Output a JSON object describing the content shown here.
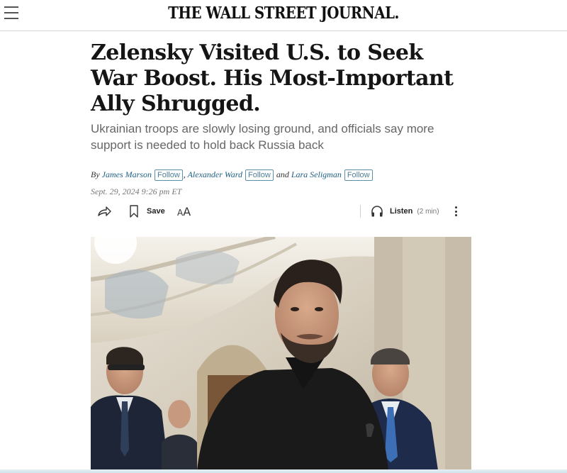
{
  "masthead": {
    "title": "THE WALL STREET JOURNAL."
  },
  "article": {
    "headline": "Zelensky Visited U.S. to Seek War Boost. His Most-Important Ally Shrugged.",
    "dek": "Ukrainian troops are slowly losing ground, and officials say more support is needed to hold back Russia back",
    "byline": {
      "by": "By",
      "authors": [
        "James Marson",
        "Alexander Ward",
        "Lara Seligman"
      ],
      "separator": ",",
      "and": "and",
      "follow_label": "Follow"
    },
    "date": "Sept. 29, 2024 9:26 pm ET"
  },
  "toolbar": {
    "share_icon": "share-arrow-icon",
    "save_label": "Save",
    "text_size_icon": "text-size-icon",
    "listen_label": "Listen",
    "listen_duration": "(2 min)",
    "more_icon": "more-vertical-icon"
  },
  "colors": {
    "author_link": "#1d5f84",
    "follow_border": "#5e8fa8",
    "dek_text": "#666666"
  }
}
